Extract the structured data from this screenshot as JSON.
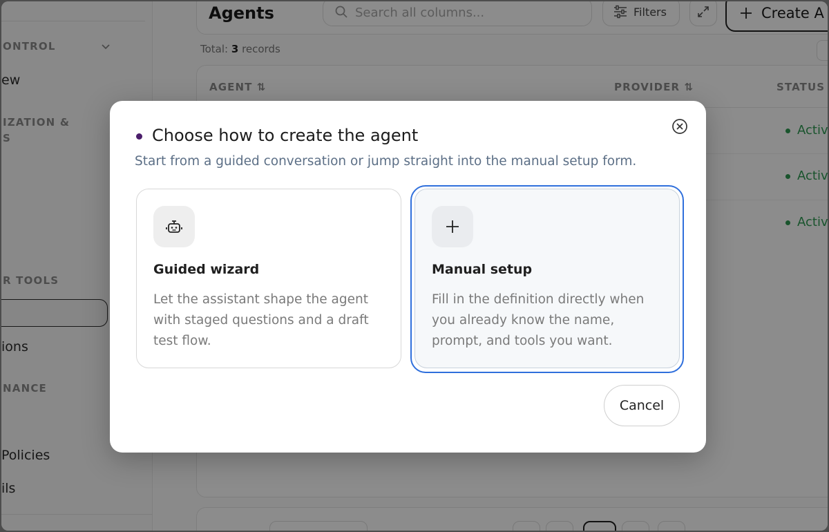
{
  "sidebar": {
    "headings": [
      "ONTROL",
      "IZATION &",
      "S",
      "R TOOLS",
      "NANCE"
    ],
    "items": [
      "ew",
      "ions",
      "Policies",
      "ils"
    ]
  },
  "main": {
    "title": "Agents",
    "search_placeholder": "Search all columns...",
    "filters_label": "Filters",
    "create_label": "Create A",
    "records_prefix": "Total: ",
    "records_count": "3",
    "records_suffix": " records",
    "columns": [
      "AGENT",
      "PROVIDER",
      "STATUS"
    ],
    "rows": [
      {
        "status": "Activ"
      },
      {
        "status": "Activ"
      },
      {
        "status": "Activ"
      }
    ]
  },
  "modal": {
    "title": "Choose how to create the agent",
    "subtitle": "Start from a guided conversation or jump straight into the manual setup form.",
    "options": [
      {
        "icon": "robot-icon",
        "title": "Guided wizard",
        "description": "Let the assistant shape the agent with staged questions and a draft test flow."
      },
      {
        "icon": "plus-icon",
        "title": "Manual setup",
        "description": "Fill in the definition directly when you already know the name, prompt, and tools you want."
      }
    ],
    "cancel_label": "Cancel"
  },
  "colors": {
    "accent_focus": "#2f6fdc",
    "status_active": "#2f9a53",
    "title_dot": "#4b1e6b"
  }
}
